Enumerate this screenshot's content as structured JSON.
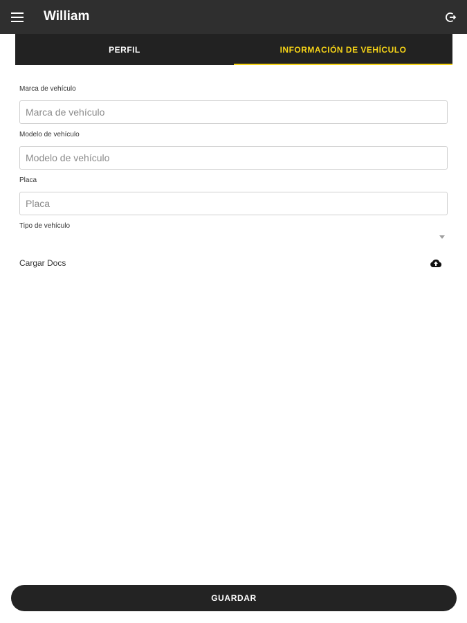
{
  "appbar": {
    "title": "William",
    "menu_icon": "menu-icon",
    "logout_icon": "logout-icon"
  },
  "tabs": [
    {
      "label": "PERFIL",
      "active": false
    },
    {
      "label": "INFORMACIÓN DE VEHÍCULO",
      "active": true
    }
  ],
  "form": {
    "brand": {
      "label": "Marca de vehículo",
      "placeholder": "Marca de vehículo",
      "value": ""
    },
    "model": {
      "label": "Modelo de vehículo",
      "placeholder": "Modelo de vehículo",
      "value": ""
    },
    "plate": {
      "label": "Placa",
      "placeholder": "Placa",
      "value": ""
    },
    "vehicle_type": {
      "label": "Tipo de vehículo",
      "value": ""
    },
    "upload": {
      "label": "Cargar Docs",
      "icon": "cloud-upload-icon"
    }
  },
  "actions": {
    "save_label": "GUARDAR"
  },
  "colors": {
    "appbar_bg": "#2f2f2f",
    "tabs_bg": "#222222",
    "accent": "#f7d417",
    "button_bg": "#232323"
  }
}
